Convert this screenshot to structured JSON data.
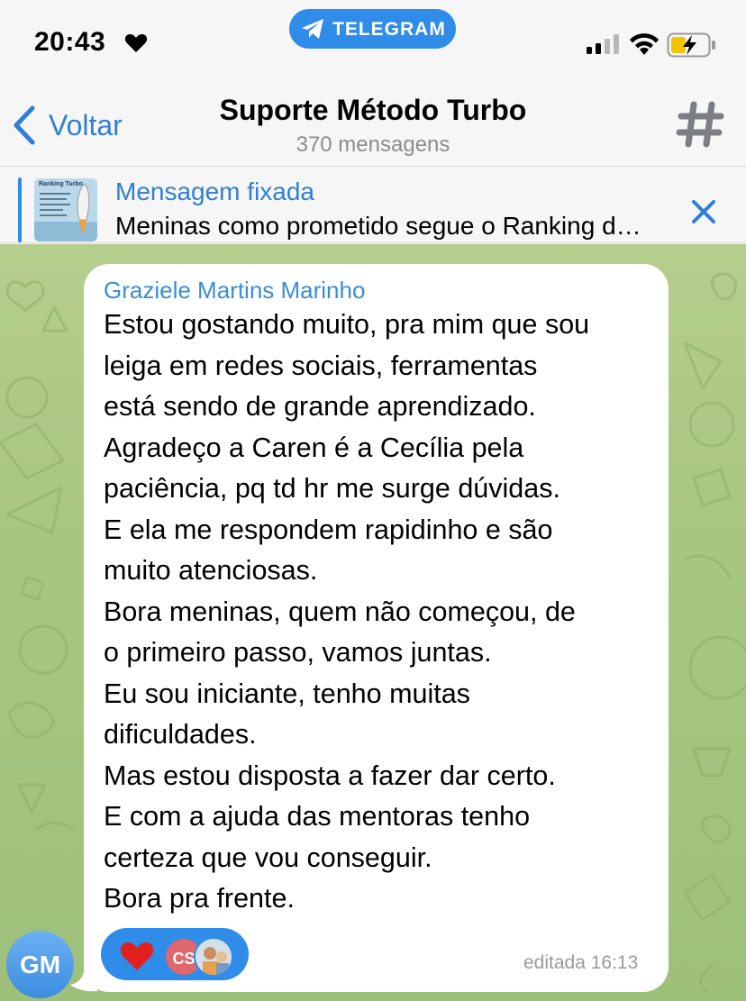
{
  "status_bar": {
    "time": "20:43",
    "app_pill": "TELEGRAM",
    "icons": [
      "heart-icon",
      "telegram-icon",
      "cellular-signal-icon",
      "wifi-icon",
      "battery-charging-icon"
    ]
  },
  "nav": {
    "back_label": "Voltar",
    "title": "Suporte Método Turbo",
    "subtitle": "370 mensagens"
  },
  "pinned": {
    "title": "Mensagem fixada",
    "text": "Meninas como prometido segue o Ranking d…",
    "thumb_caption": "Ranking Turbo"
  },
  "message": {
    "sender": "Graziele Martins Marinho",
    "lines": [
      "Estou gostando muito, pra mim que sou",
      "leiga em redes sociais, ferramentas",
      "está sendo de grande aprendizado.",
      "Agradeço a Caren é a Cecília pela",
      "paciência, pq td hr me surge dúvidas.",
      "E ela me respondem rapidinho e são",
      "muito atenciosas.",
      "Bora meninas, quem não começou, de",
      "o primeiro passo, vamos juntas.",
      "Eu sou iniciante, tenho muitas",
      "dificuldades.",
      "Mas estou disposta a fazer dar certo.",
      "E com a ajuda das mentoras tenho",
      "certeza que vou conseguir.",
      "Bora pra frente."
    ],
    "timestamp": "editada 16:13",
    "reaction_avatar": "CS",
    "sender_avatar": "GM"
  },
  "colors": {
    "accent": "#2f8ce8",
    "link": "#2f7fd6",
    "sender_name": "#3a8ed1",
    "chat_background": "#a9c682",
    "reaction_heart": "#e0201c",
    "avatar_cs": "#e0676a"
  }
}
